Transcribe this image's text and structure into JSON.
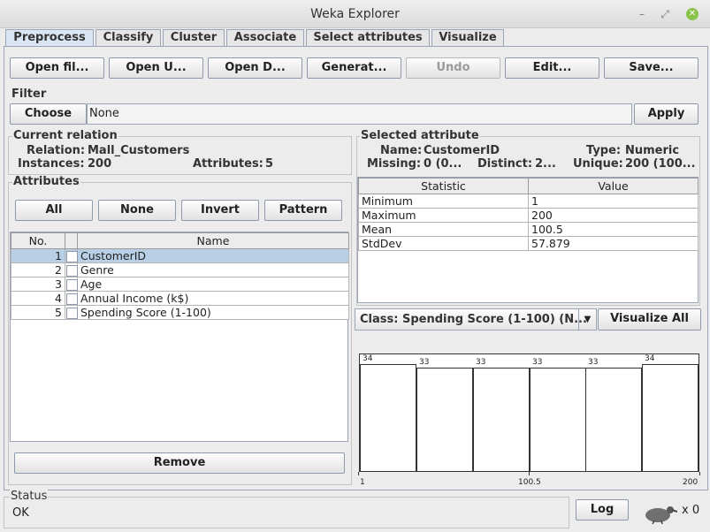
{
  "window": {
    "title": "Weka Explorer"
  },
  "tabs": [
    "Preprocess",
    "Classify",
    "Cluster",
    "Associate",
    "Select attributes",
    "Visualize"
  ],
  "toolbar": {
    "open_file": "Open fil...",
    "open_url": "Open U...",
    "open_db": "Open D...",
    "generate": "Generat...",
    "undo": "Undo",
    "edit": "Edit...",
    "save": "Save..."
  },
  "filter": {
    "title": "Filter",
    "choose": "Choose",
    "value": "None",
    "apply": "Apply"
  },
  "current_relation": {
    "title": "Current relation",
    "relation_label": "Relation:",
    "relation": "Mall_Customers",
    "instances_label": "Instances:",
    "instances": "200",
    "attributes_label": "Attributes:",
    "attributes": "5"
  },
  "attributes_panel": {
    "title": "Attributes",
    "buttons": {
      "all": "All",
      "none": "None",
      "invert": "Invert",
      "pattern": "Pattern"
    },
    "columns": {
      "no": "No.",
      "name": "Name"
    },
    "rows": [
      {
        "no": "1",
        "name": "CustomerID"
      },
      {
        "no": "2",
        "name": "Genre"
      },
      {
        "no": "3",
        "name": "Age"
      },
      {
        "no": "4",
        "name": "Annual Income (k$)"
      },
      {
        "no": "5",
        "name": "Spending Score (1-100)"
      }
    ],
    "remove": "Remove"
  },
  "selected_attribute": {
    "title": "Selected attribute",
    "name_label": "Name:",
    "name": "CustomerID",
    "type_label": "Type:",
    "type": "Numeric",
    "missing_label": "Missing:",
    "missing": "0 (0...",
    "distinct_label": "Distinct:",
    "distinct": "2...",
    "unique_label": "Unique:",
    "unique": "200 (100...",
    "columns": {
      "statistic": "Statistic",
      "value": "Value"
    },
    "stats": [
      {
        "statistic": "Minimum",
        "value": "1"
      },
      {
        "statistic": "Maximum",
        "value": "200"
      },
      {
        "statistic": "Mean",
        "value": "100.5"
      },
      {
        "statistic": "StdDev",
        "value": "57.879"
      }
    ]
  },
  "class_selector": {
    "value": "Class: Spending Score (1-100) (N...",
    "visualize_all": "Visualize All"
  },
  "histogram": {
    "counts": [
      34,
      33,
      33,
      33,
      33,
      34
    ],
    "count_labels": [
      "34",
      "33",
      "33",
      "33",
      "33",
      "34"
    ],
    "x_min": "1",
    "x_mid": "100.5",
    "x_max": "200"
  },
  "status": {
    "title": "Status",
    "text": "OK",
    "log": "Log",
    "tasks": "x 0"
  }
}
